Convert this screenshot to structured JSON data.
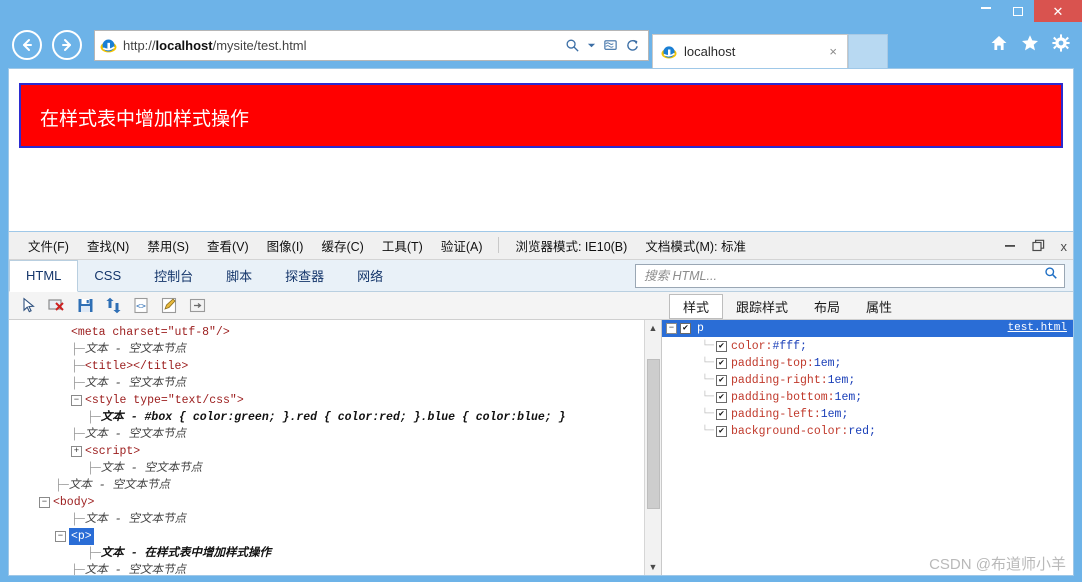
{
  "browser": {
    "window_controls": {
      "minimize": "minimize-icon",
      "maximize": "maximize-icon",
      "close": "close-icon"
    },
    "back_label": "back-arrow",
    "forward_label": "forward-arrow",
    "url": "http://localhost/mysite/test.html",
    "url_scheme": "http://",
    "url_host": "localhost",
    "url_path": "/mysite/test.html",
    "address_icons": [
      "search-icon",
      "dropdown-caret-icon",
      "compatibility-view-icon",
      "refresh-icon"
    ],
    "tab": {
      "title": "localhost",
      "close": "×"
    },
    "toolbar_icons": [
      "home-icon",
      "favorites-star-icon",
      "settings-gear-icon"
    ]
  },
  "page": {
    "paragraph_text": "在样式表中增加样式操作",
    "background_color": "#ff0000",
    "text_color": "#ffffff",
    "border_color": "#2b2bd0"
  },
  "devtools": {
    "menubar": [
      "文件(F)",
      "查找(N)",
      "禁用(S)",
      "查看(V)",
      "图像(I)",
      "缓存(C)",
      "工具(T)",
      "验证(A)"
    ],
    "browser_mode": "浏览器模式: IE10(B)",
    "document_mode": "文档模式(M): 标准",
    "window_controls": {
      "minimize": "—",
      "restore": "restore-icon",
      "close": "x"
    },
    "tabs": [
      {
        "label": "HTML",
        "active": true
      },
      {
        "label": "CSS",
        "active": false
      },
      {
        "label": "控制台",
        "active": false
      },
      {
        "label": "脚本",
        "active": false
      },
      {
        "label": "探查器",
        "active": false
      },
      {
        "label": "网络",
        "active": false
      }
    ],
    "search": {
      "placeholder": "搜索 HTML...",
      "value": ""
    },
    "toolbar_icons": [
      "select-element-cursor-icon",
      "clear-browser-cache-icon",
      "save-icon",
      "refresh-styles-icon",
      "view-source-icon",
      "edit-icon",
      "outline-icon"
    ],
    "right_tabs": [
      {
        "label": "样式",
        "active": true
      },
      {
        "label": "跟踪样式",
        "active": false
      },
      {
        "label": "布局",
        "active": false
      },
      {
        "label": "属性",
        "active": false
      }
    ],
    "dom_tree": [
      {
        "indent": 3,
        "expander": "",
        "twig": "",
        "type": "tag",
        "text": "<meta charset=\"utf-8\"/>"
      },
      {
        "indent": 3,
        "expander": "",
        "twig": "└",
        "type": "text",
        "text": "文本 - 空文本节点"
      },
      {
        "indent": 3,
        "expander": "",
        "twig": "└",
        "type": "tag",
        "text": "<title></title>"
      },
      {
        "indent": 3,
        "expander": "",
        "twig": "└",
        "type": "text",
        "text": "文本 - 空文本节点"
      },
      {
        "indent": 3,
        "expander": "-",
        "twig": "",
        "type": "tag",
        "text": "<style type=\"text/css\">"
      },
      {
        "indent": 4,
        "expander": "",
        "twig": "└",
        "type": "textval",
        "text": "文本 - #box { color:green; }.red { color:red; }.blue { color:blue; }"
      },
      {
        "indent": 3,
        "expander": "",
        "twig": "└",
        "type": "text",
        "text": "文本 - 空文本节点"
      },
      {
        "indent": 3,
        "expander": "+",
        "twig": "",
        "type": "tag",
        "text": "<script>"
      },
      {
        "indent": 4,
        "expander": "",
        "twig": "└",
        "type": "text",
        "text": "文本 - 空文本节点"
      },
      {
        "indent": 2,
        "expander": "",
        "twig": "└",
        "type": "text",
        "text": "文本 - 空文本节点"
      },
      {
        "indent": 1,
        "expander": "-",
        "twig": "",
        "type": "tag",
        "text": "<body>"
      },
      {
        "indent": 3,
        "expander": "",
        "twig": "└",
        "type": "text",
        "text": "文本 - 空文本节点"
      },
      {
        "indent": 2,
        "expander": "-",
        "twig": "",
        "type": "selected",
        "text": "<p>"
      },
      {
        "indent": 4,
        "expander": "",
        "twig": "└",
        "type": "textval",
        "text": "文本 - 在样式表中增加样式操作"
      },
      {
        "indent": 3,
        "expander": "",
        "twig": "└",
        "type": "text",
        "text": "文本 - 空文本节点"
      }
    ],
    "styles": {
      "selector": "p",
      "source": "test.html",
      "rules": [
        {
          "checked": true,
          "property": "color",
          "value": "#fff;"
        },
        {
          "checked": true,
          "property": "padding-top",
          "value": "1em;"
        },
        {
          "checked": true,
          "property": "padding-right",
          "value": "1em;"
        },
        {
          "checked": true,
          "property": "padding-bottom",
          "value": "1em;"
        },
        {
          "checked": true,
          "property": "padding-left",
          "value": "1em;"
        },
        {
          "checked": true,
          "property": "background-color",
          "value": "red;"
        }
      ]
    }
  },
  "watermark": "CSDN @布道师小羊",
  "colors": {
    "chrome_blue": "#6db3e8",
    "close_red": "#d9534f",
    "selection_blue": "#2a6dd6",
    "banner_red": "#ff0000"
  }
}
